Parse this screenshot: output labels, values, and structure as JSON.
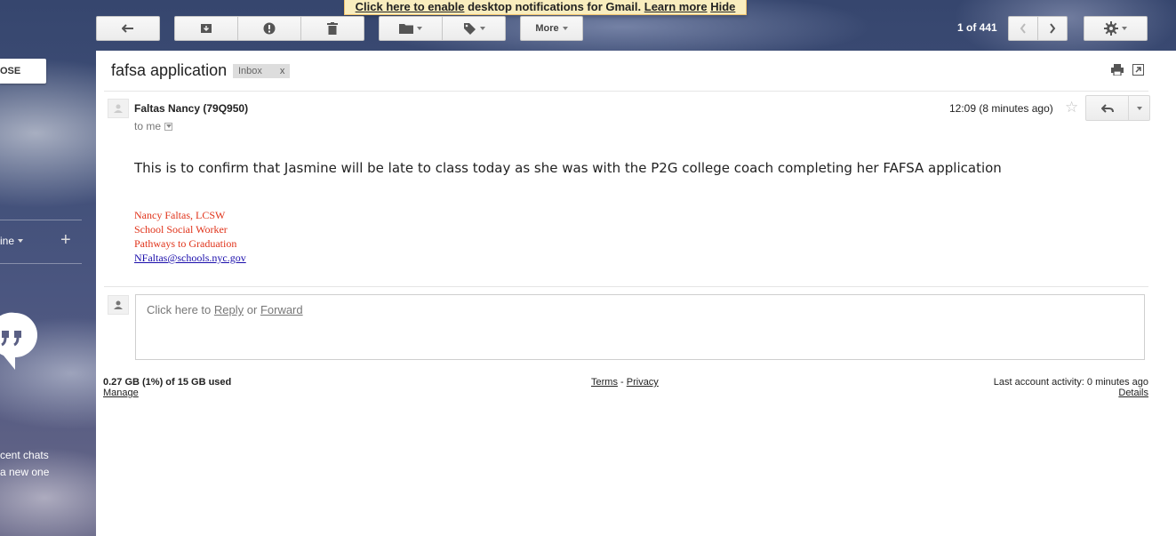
{
  "notification": {
    "enable_link": "Click here to enable",
    "text": "desktop notifications for Gmail.",
    "learn_more": "Learn more",
    "hide": "Hide"
  },
  "toolbar": {
    "more_label": "More",
    "pager": "1 of 441"
  },
  "sidebar": {
    "compose_label": "OSE",
    "account_label": "ine",
    "recent_chats_line1": "cent chats",
    "recent_chats_line2": "a new one"
  },
  "email": {
    "subject": "fafsa application",
    "label": "Inbox",
    "label_remove": "x",
    "sender": "Faltas Nancy (79Q950)",
    "recipient": "to me",
    "time": "12:09 (8 minutes ago)",
    "body": "This is to confirm that Jasmine will be late to class today as she was with the P2G college coach completing her FAFSA application",
    "signature": {
      "name": "Nancy Faltas, LCSW",
      "title": "School Social Worker",
      "program": "Pathways to Graduation",
      "email": "NFaltas@schools.nyc.gov"
    }
  },
  "reply_box": {
    "prefix": "Click here to",
    "reply": "Reply",
    "or": "or",
    "forward": "Forward"
  },
  "footer": {
    "storage": "0.27 GB (1%) of 15 GB used",
    "manage": "Manage",
    "terms": "Terms",
    "sep": "-",
    "privacy": "Privacy",
    "activity": "Last account activity: 0 minutes ago",
    "details": "Details"
  },
  "colors": {
    "signature": "#e0331a",
    "link": "#1a0dab",
    "notification_bg": "#f9edbe"
  }
}
